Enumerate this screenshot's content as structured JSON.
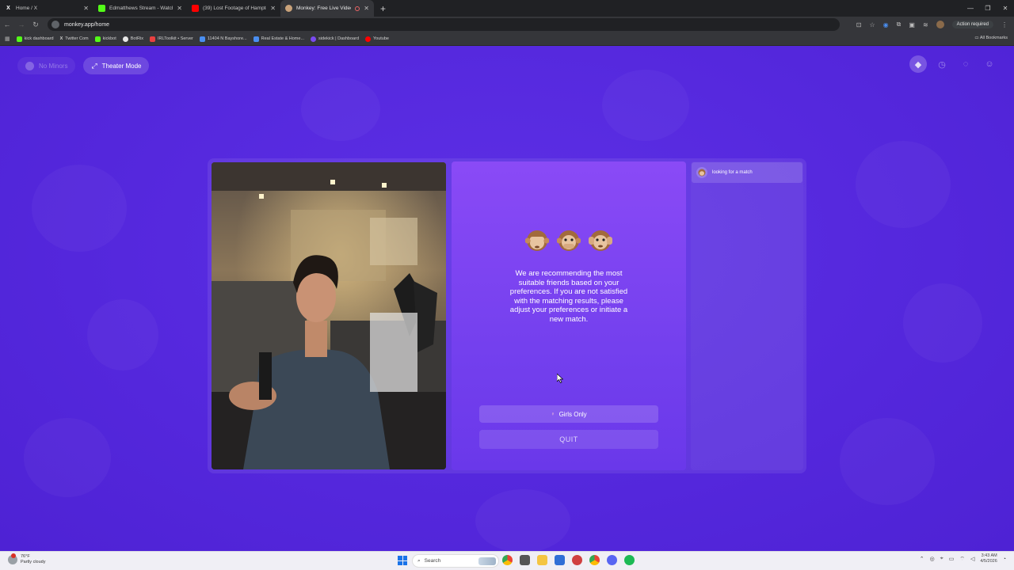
{
  "browser": {
    "tabs": [
      {
        "title": "Home / X",
        "icon": "x-logo-icon",
        "active": false
      },
      {
        "title": "Edmatthews Stream - Watch Li",
        "icon": "kick-logo-icon",
        "active": false
      },
      {
        "title": "(39) Lost Footage of Hampton",
        "icon": "youtube-icon",
        "active": false
      },
      {
        "title": "Monkey: Free Live Video Ch",
        "icon": "monkey-icon",
        "active": true
      }
    ],
    "url": "monkey.app/home",
    "action_label": "Action required",
    "bookmarks": [
      {
        "label": "kick dashboard",
        "color": "#53fc18"
      },
      {
        "label": "Twitter Com",
        "color": "#ffffff"
      },
      {
        "label": "kickbot",
        "color": "#53fc18"
      },
      {
        "label": "BotRix",
        "color": "#e8e8e8"
      },
      {
        "label": "IRLToolkit • Server",
        "color": "#e84040"
      },
      {
        "label": "11404 N Bayshore...",
        "color": "#4a8ef0"
      },
      {
        "label": "Real Estate & Home...",
        "color": "#4a8ef0"
      },
      {
        "label": "sidekick | Dashboard",
        "color": "#7a4af0"
      },
      {
        "label": "Youtube",
        "color": "#ff0000"
      }
    ],
    "all_bookmarks": "All Bookmarks"
  },
  "page": {
    "no_minors": "No Minors",
    "theater_mode": "Theater Mode",
    "match_message": "We are recommending the most suitable friends based on your preferences. If you are not satisfied with the matching results, please adjust your preferences or initiate a new match.",
    "girls_only": "Girls Only",
    "quit": "QUIT",
    "looking_for_match": "looking for a match"
  },
  "taskbar": {
    "temperature": "76°F",
    "weather": "Partly cloudy",
    "search_placeholder": "Search",
    "time": "3:43 AM",
    "date": "4/5/2026"
  },
  "colors": {
    "accent": "#5a2be0",
    "panel": "#8a4af6"
  }
}
